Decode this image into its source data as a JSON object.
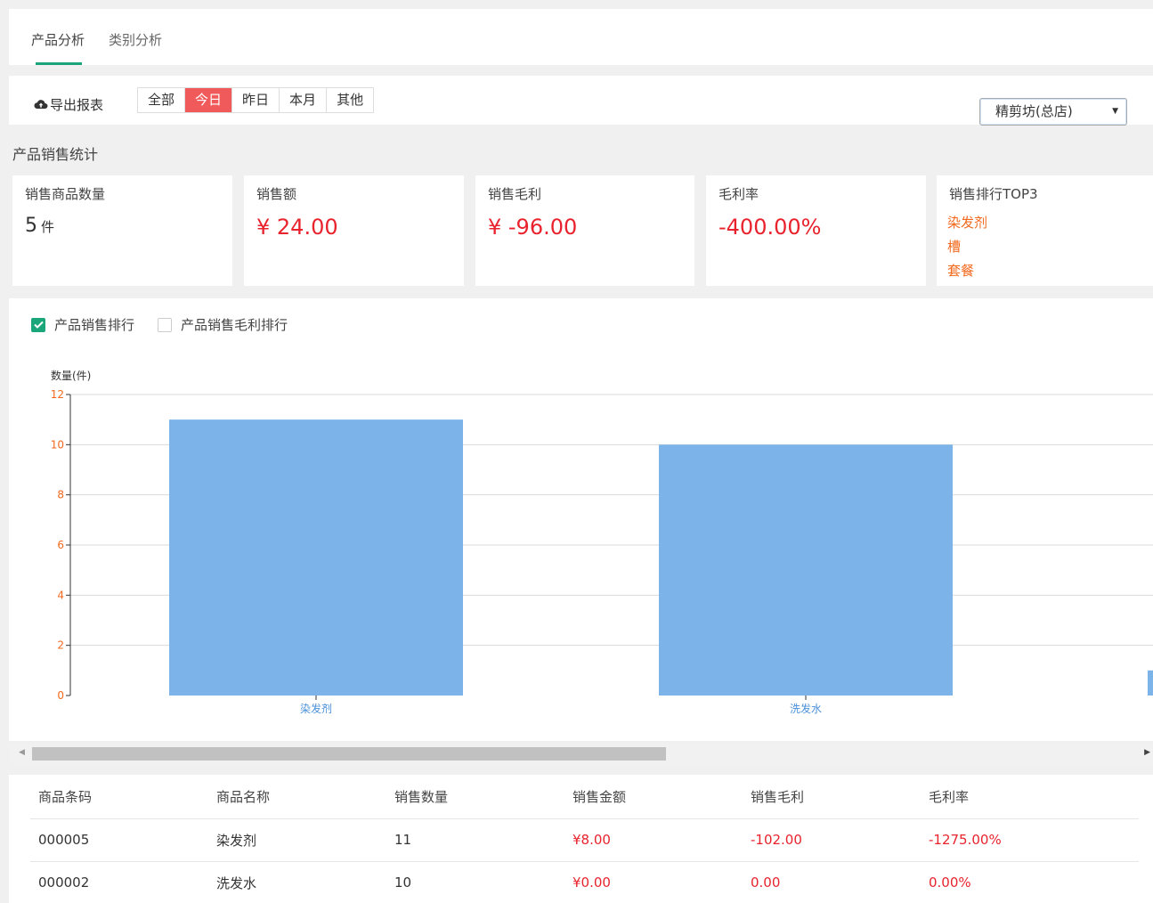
{
  "tabs": [
    {
      "label": "产品分析",
      "active": true
    },
    {
      "label": "类别分析",
      "active": false
    }
  ],
  "toolbar": {
    "export_label": "导出报表",
    "periods": [
      {
        "label": "全部",
        "active": false
      },
      {
        "label": "今日",
        "active": true
      },
      {
        "label": "昨日",
        "active": false
      },
      {
        "label": "本月",
        "active": false
      },
      {
        "label": "其他",
        "active": false
      }
    ],
    "store": "精剪坊(总店)"
  },
  "section_title": "产品销售统计",
  "stats": {
    "qty": {
      "label": "销售商品数量",
      "value": "5",
      "unit": "件"
    },
    "amount": {
      "label": "销售额",
      "value": "¥ 24.00"
    },
    "profit": {
      "label": "销售毛利",
      "value": "¥ -96.00"
    },
    "margin": {
      "label": "毛利率",
      "value": "-400.00%"
    },
    "top3": {
      "label": "销售排行TOP3",
      "items": [
        "染发剂",
        "槽",
        "套餐"
      ]
    }
  },
  "chart_toggles": [
    {
      "label": "产品销售排行",
      "checked": true
    },
    {
      "label": "产品销售毛利排行",
      "checked": false
    }
  ],
  "chart_data": {
    "type": "bar",
    "ylabel": "数量(件)",
    "ylim": [
      0,
      12
    ],
    "yticks": [
      "0",
      "2",
      "4",
      "6",
      "8",
      "10",
      "12"
    ],
    "categories": [
      "染发剂",
      "洗发水"
    ],
    "values": [
      11,
      10
    ],
    "grid": true,
    "bar_color": "#7cb3e9",
    "tick_color": "#f2691e"
  },
  "table": {
    "headers": [
      "商品条码",
      "商品名称",
      "销售数量",
      "销售金额",
      "销售毛利",
      "毛利率"
    ],
    "rows": [
      [
        "000005",
        "染发剂",
        "11",
        "¥8.00",
        "-102.00",
        "-1275.00%"
      ],
      [
        "000002",
        "洗发水",
        "10",
        "¥0.00",
        "0.00",
        "0.00%"
      ]
    ]
  },
  "colors": {
    "accent": "#1aa57a",
    "active_period": "#f05a5a",
    "negative": "#e8232e",
    "top3": "#f2691e"
  }
}
